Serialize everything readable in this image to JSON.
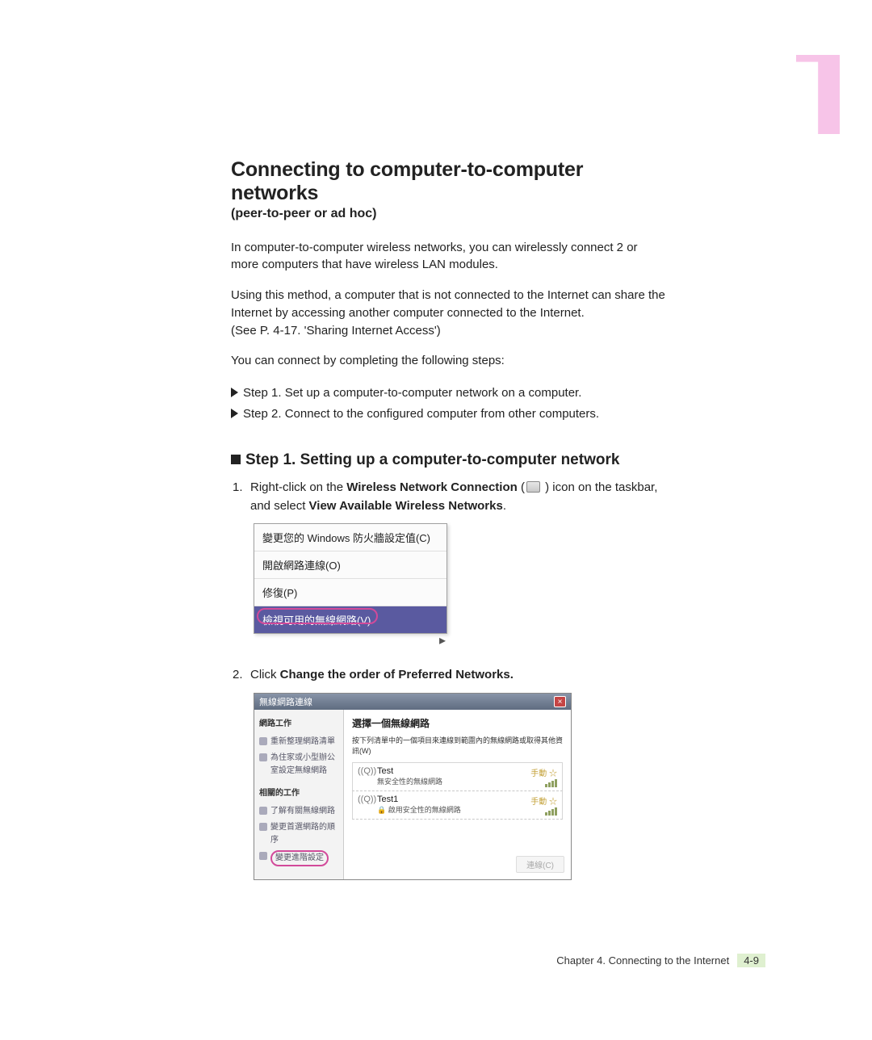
{
  "chapter_marker": "1",
  "title": "Connecting to computer-to-computer networks",
  "subtitle": "(peer-to-peer or ad hoc)",
  "para1": "In computer-to-computer wireless networks, you can wirelessly connect 2 or more computers that have wireless LAN modules.",
  "para2": "Using this method, a computer that is not connected to the Internet can share the Internet by accessing another computer connected to the Internet.",
  "para2b": "(See P. 4-17. 'Sharing Internet Access')",
  "para3": "You can connect by completing the following steps:",
  "step_a": "Step 1. Set up a computer-to-computer network on a computer.",
  "step_b": "Step 2. Connect to the configured computer from other computers.",
  "section1": "Step 1. Setting up a computer-to-computer network",
  "instr1_pre": "Right-click on the ",
  "instr1_bold": "Wireless Network Connection",
  "instr1_mid": " (",
  "instr1_post": " ) icon on the taskbar, and select ",
  "instr1_bold2": "View Available Wireless Networks",
  "instr1_end": ".",
  "menu": {
    "item1": "變更您的 Windows 防火牆設定值(C)",
    "item2": "開啟網路連線(O)",
    "item3": "修復(P)",
    "item4": "檢視可用的無線網路(V)"
  },
  "instr2_pre": "Click ",
  "instr2_bold": "Change the order of Preferred Networks.",
  "dialog": {
    "title": "無線網路連線",
    "left_h1": "網路工作",
    "left_l1": "重新整理網路清單",
    "left_l2": "為住家或小型辦公室設定無線網路",
    "left_h2": "相關的工作",
    "left_l3": "了解有關無線網路",
    "left_l4": "變更首選網路的順序",
    "left_l5": "變更進階設定",
    "right_h": "選擇一個無線網路",
    "right_sub": "按下列清單中的一個項目來連線到範圍內的無線網路或取得其他資訊(W)",
    "net1_name": "Test",
    "net1_desc": "無安全性的無線網路",
    "net1_status": "手動 ☆",
    "net2_name": "Test1",
    "net2_desc": "啟用安全性的無線網路",
    "net2_status": "手動 ☆",
    "connect": "連線(C)"
  },
  "footer_text": "Chapter 4. Connecting to the Internet",
  "footer_pg": "4-9"
}
